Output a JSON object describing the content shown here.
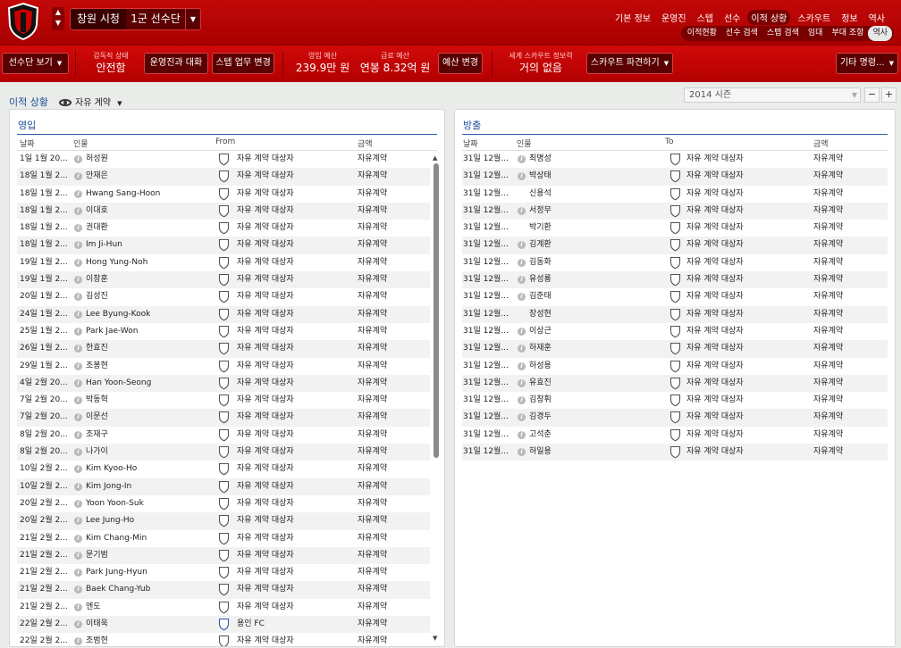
{
  "header": {
    "club_name": "창원 시청",
    "squad": "1군 선수단",
    "main_nav": [
      "기본 정보",
      "운영진",
      "스텝",
      "선수",
      "이적 상황",
      "스카우트",
      "정보",
      "역사"
    ],
    "main_nav_active": 4,
    "sub_nav": [
      "이적현황",
      "선수 검색",
      "스텝 검색",
      "임대",
      "부대 조항",
      "역사"
    ],
    "sub_nav_active": 5
  },
  "toolbar": {
    "squad_view": "선수단 보기",
    "manager_status_label": "감독직 상태",
    "manager_status_value": "안전함",
    "talk_board": "운영진과 대화",
    "staff_duty": "스텝 업무 변경",
    "transfer_budget_label": "영입 예산",
    "transfer_budget_value": "239.9만 원",
    "wage_budget_label": "급료 예산",
    "wage_budget_value": "연봉 8.32억 원",
    "budget_change": "예산 변경",
    "world_scout_label": "세계 스카우트 정보력",
    "world_scout_value": "거의 없음",
    "send_scout": "스카우트 파견하기",
    "other_orders": "기타 명령..."
  },
  "content": {
    "title": "이적 상황",
    "view": "자유 계약",
    "season": "2014 시즌",
    "minus": "−",
    "plus": "+"
  },
  "incoming": {
    "title": "영입",
    "headers": {
      "date": "날짜",
      "person": "인물",
      "from": "From",
      "fee": "금액"
    },
    "rows": [
      {
        "date": "1일 1월 20...",
        "name": "허성원",
        "club": "자유 계약 대상자",
        "fee": "자유계약",
        "info": true
      },
      {
        "date": "18일 1월 2...",
        "name": "안재은",
        "club": "자유 계약 대상자",
        "fee": "자유계약",
        "info": true
      },
      {
        "date": "18일 1월 2...",
        "name": "Hwang Sang-Hoon",
        "club": "자유 계약 대상자",
        "fee": "자유계약",
        "info": true
      },
      {
        "date": "18일 1월 2...",
        "name": "이대호",
        "club": "자유 계약 대상자",
        "fee": "자유계약",
        "info": true
      },
      {
        "date": "18일 1월 2...",
        "name": "권대환",
        "club": "자유 계약 대상자",
        "fee": "자유계약",
        "info": true
      },
      {
        "date": "18일 1월 2...",
        "name": "Im Ji-Hun",
        "club": "자유 계약 대상자",
        "fee": "자유계약",
        "info": true
      },
      {
        "date": "19일 1월 2...",
        "name": "Hong Yung-Noh",
        "club": "자유 계약 대상자",
        "fee": "자유계약",
        "info": true
      },
      {
        "date": "19일 1월 2...",
        "name": "이창훈",
        "club": "자유 계약 대상자",
        "fee": "자유계약",
        "info": true
      },
      {
        "date": "20일 1월 2...",
        "name": "김성진",
        "club": "자유 계약 대상자",
        "fee": "자유계약",
        "info": true
      },
      {
        "date": "24일 1월 2...",
        "name": "Lee Byung-Kook",
        "club": "자유 계약 대상자",
        "fee": "자유계약",
        "info": true
      },
      {
        "date": "25일 1월 2...",
        "name": "Park Jae-Won",
        "club": "자유 계약 대상자",
        "fee": "자유계약",
        "info": true
      },
      {
        "date": "26일 1월 2...",
        "name": "한효진",
        "club": "자유 계약 대상자",
        "fee": "자유계약",
        "info": true
      },
      {
        "date": "29일 1월 2...",
        "name": "조봉현",
        "club": "자유 계약 대상자",
        "fee": "자유계약",
        "info": true
      },
      {
        "date": "4일 2월 20...",
        "name": "Han Yoon-Seong",
        "club": "자유 계약 대상자",
        "fee": "자유계약",
        "info": true
      },
      {
        "date": "7일 2월 20...",
        "name": "박동혁",
        "club": "자유 계약 대상자",
        "fee": "자유계약",
        "info": true
      },
      {
        "date": "7일 2월 20...",
        "name": "이문선",
        "club": "자유 계약 대상자",
        "fee": "자유계약",
        "info": true
      },
      {
        "date": "8일 2월 20...",
        "name": "조재구",
        "club": "자유 계약 대상자",
        "fee": "자유계약",
        "info": true
      },
      {
        "date": "8일 2월 20...",
        "name": "나가이",
        "club": "자유 계약 대상자",
        "fee": "자유계약",
        "info": true
      },
      {
        "date": "10일 2월 2...",
        "name": "Kim Kyoo-Ho",
        "club": "자유 계약 대상자",
        "fee": "자유계약",
        "info": true
      },
      {
        "date": "10일 2월 2...",
        "name": "Kim Jong-In",
        "club": "자유 계약 대상자",
        "fee": "자유계약",
        "info": true
      },
      {
        "date": "20일 2월 2...",
        "name": "Yoon Yoon-Suk",
        "club": "자유 계약 대상자",
        "fee": "자유계약",
        "info": true
      },
      {
        "date": "20일 2월 2...",
        "name": "Lee Jung-Ho",
        "club": "자유 계약 대상자",
        "fee": "자유계약",
        "info": true
      },
      {
        "date": "21일 2월 2...",
        "name": "Kim Chang-Min",
        "club": "자유 계약 대상자",
        "fee": "자유계약",
        "info": true
      },
      {
        "date": "21일 2월 2...",
        "name": "문기범",
        "club": "자유 계약 대상자",
        "fee": "자유계약",
        "info": true
      },
      {
        "date": "21일 2월 2...",
        "name": "Park Jung-Hyun",
        "club": "자유 계약 대상자",
        "fee": "자유계약",
        "info": true
      },
      {
        "date": "21일 2월 2...",
        "name": "Baek Chang-Yub",
        "club": "자유 계약 대상자",
        "fee": "자유계약",
        "info": true
      },
      {
        "date": "21일 2월 2...",
        "name": "엔도",
        "club": "자유 계약 대상자",
        "fee": "자유계약",
        "info": true
      },
      {
        "date": "22일 2월 2...",
        "name": "이태욱",
        "club": "용인 FC",
        "fee": "자유계약",
        "info": true,
        "club_color": "#2a5ea8"
      },
      {
        "date": "22일 2월 2...",
        "name": "조범현",
        "club": "자유 계약 대상자",
        "fee": "자유계약",
        "info": true
      }
    ]
  },
  "outgoing": {
    "title": "방출",
    "headers": {
      "date": "날짜",
      "person": "인물",
      "to": "To",
      "fee": "금액"
    },
    "rows": [
      {
        "date": "31일 12월...",
        "name": "최명성",
        "club": "자유 계약 대상자",
        "fee": "자유계약",
        "info": true
      },
      {
        "date": "31일 12월...",
        "name": "박상태",
        "club": "자유 계약 대상자",
        "fee": "자유계약",
        "info": true
      },
      {
        "date": "31일 12월...",
        "name": "신용석",
        "club": "자유 계약 대상자",
        "fee": "자유계약",
        "info": false
      },
      {
        "date": "31일 12월...",
        "name": "서정무",
        "club": "자유 계약 대상자",
        "fee": "자유계약",
        "info": true
      },
      {
        "date": "31일 12월...",
        "name": "박기환",
        "club": "자유 계약 대상자",
        "fee": "자유계약",
        "info": false
      },
      {
        "date": "31일 12월...",
        "name": "김계환",
        "club": "자유 계약 대상자",
        "fee": "자유계약",
        "info": true
      },
      {
        "date": "31일 12월...",
        "name": "김동화",
        "club": "자유 계약 대상자",
        "fee": "자유계약",
        "info": true
      },
      {
        "date": "31일 12월...",
        "name": "유성룡",
        "club": "자유 계약 대상자",
        "fee": "자유계약",
        "info": true
      },
      {
        "date": "31일 12월...",
        "name": "김준태",
        "club": "자유 계약 대상자",
        "fee": "자유계약",
        "info": true
      },
      {
        "date": "31일 12월...",
        "name": "장성현",
        "club": "자유 계약 대상자",
        "fee": "자유계약",
        "info": false
      },
      {
        "date": "31일 12월...",
        "name": "이상근",
        "club": "자유 계약 대상자",
        "fee": "자유계약",
        "info": true
      },
      {
        "date": "31일 12월...",
        "name": "하재훈",
        "club": "자유 계약 대상자",
        "fee": "자유계약",
        "info": true
      },
      {
        "date": "31일 12월...",
        "name": "하성용",
        "club": "자유 계약 대상자",
        "fee": "자유계약",
        "info": true
      },
      {
        "date": "31일 12월...",
        "name": "유효진",
        "club": "자유 계약 대상자",
        "fee": "자유계약",
        "info": true
      },
      {
        "date": "31일 12월...",
        "name": "김창휘",
        "club": "자유 계약 대상자",
        "fee": "자유계약",
        "info": true
      },
      {
        "date": "31일 12월...",
        "name": "김경두",
        "club": "자유 계약 대상자",
        "fee": "자유계약",
        "info": true
      },
      {
        "date": "31일 12월...",
        "name": "고석춘",
        "club": "자유 계약 대상자",
        "fee": "자유계약",
        "info": true
      },
      {
        "date": "31일 12월...",
        "name": "하일용",
        "club": "자유 계약 대상자",
        "fee": "자유계약",
        "info": true
      }
    ]
  },
  "colors": {
    "brand_red": "#b30000",
    "accent_blue": "#1d4f99"
  }
}
